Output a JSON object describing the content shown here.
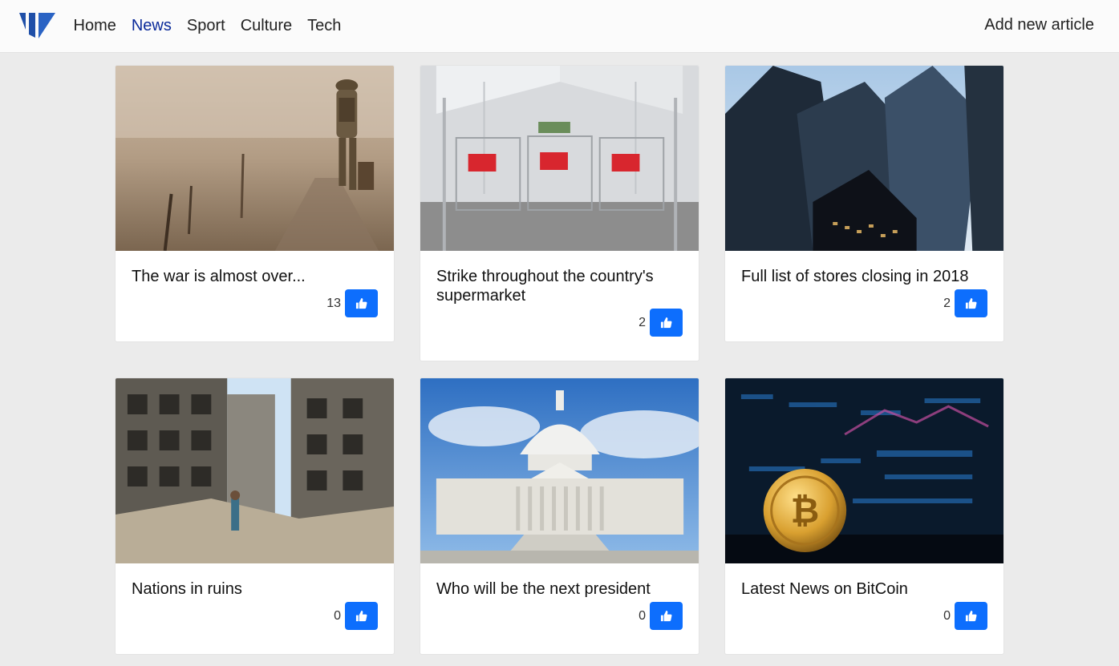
{
  "nav": {
    "links": [
      {
        "label": "Home"
      },
      {
        "label": "News",
        "active": true
      },
      {
        "label": "Sport"
      },
      {
        "label": "Culture"
      },
      {
        "label": "Tech"
      }
    ],
    "add_article": "Add new article"
  },
  "colors": {
    "accent": "#0d6efd",
    "active_link": "#0a2a9a",
    "logo": "#1f4fa8",
    "background": "#ebebeb"
  },
  "icons": {
    "like": "thumbs-up-icon",
    "logo": "brand-logo-icon"
  },
  "articles": [
    {
      "title": "The war is almost over...",
      "likes": "13",
      "image": "soldier-walking-image"
    },
    {
      "title": "Strike throughout the country's supermarket",
      "likes": "2",
      "image": "shopping-carts-image"
    },
    {
      "title": "Full list of stores closing in 2018",
      "likes": "2",
      "image": "skyscrapers-image"
    },
    {
      "title": "Nations in ruins",
      "likes": "0",
      "image": "ruined-buildings-image"
    },
    {
      "title": "Who will be the next president",
      "likes": "0",
      "image": "capitol-building-image"
    },
    {
      "title": "Latest News on BitCoin",
      "likes": "0",
      "image": "bitcoin-coin-image"
    }
  ]
}
